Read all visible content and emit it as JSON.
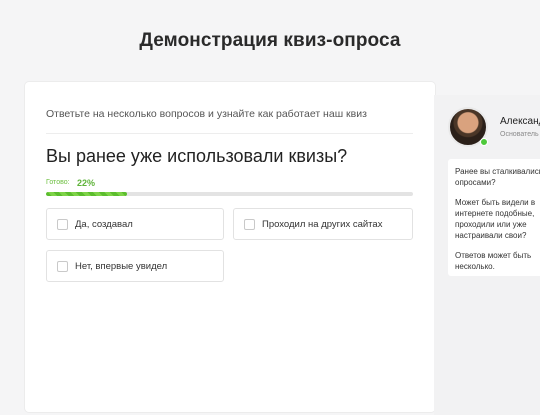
{
  "page": {
    "title": "Демонстрация квиз-опроса"
  },
  "quiz": {
    "subtitle": "Ответьте на несколько вопросов и узнайте как работает наш квиз",
    "question": "Вы ранее уже использовали квизы?",
    "progress": {
      "label": "Готово:",
      "value_text": "22%",
      "fraction": 0.22
    },
    "options": [
      {
        "label": "Да, создавал"
      },
      {
        "label": "Проходил на других сайтах"
      },
      {
        "label": "Нет, впервые увидел"
      }
    ]
  },
  "consultant": {
    "name": "Александ",
    "role": "Основатель",
    "messages": [
      "Ранее вы сталкивались с опросами?",
      "Может быть видели в интернете подобные, проходили или уже настраивали свои?",
      "Ответов может быть несколько."
    ],
    "online_color": "#4ec93b"
  },
  "colors": {
    "accent": "#5fb33a",
    "background": "#f5f5f6"
  }
}
